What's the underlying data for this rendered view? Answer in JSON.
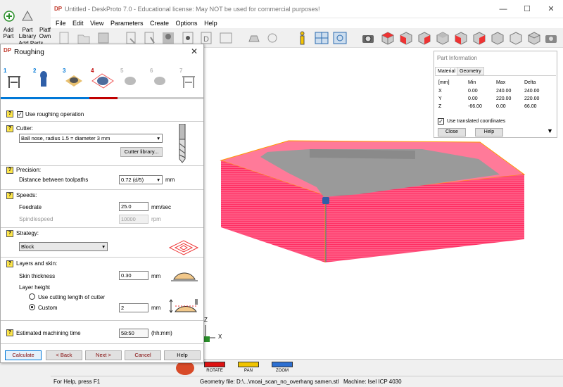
{
  "window": {
    "title": "Untitled - DeskProto 7.0 - Educational license: May NOT be used for commercial purposes!",
    "icon": "DP"
  },
  "bg_toolbar": {
    "add_part": [
      "Add",
      "Part"
    ],
    "part_library": [
      "Part",
      "Library"
    ],
    "platform": [
      "Platf",
      "Own"
    ],
    "add_parts": "Add Parts"
  },
  "menu": [
    "File",
    "Edit",
    "View",
    "Parameters",
    "Create",
    "Options",
    "Help"
  ],
  "dialog": {
    "title": "Roughing",
    "steps": [
      "1",
      "2",
      "3",
      "4",
      "5",
      "6",
      "7"
    ],
    "use_roughing": "Use roughing operation",
    "cutter_label": "Cutter:",
    "cutter_value": "Ball nose, radius 1.5 = diameter 3 mm",
    "cutter_library": "Cutter library...",
    "precision_label": "Precision:",
    "distance_label": "Distance between toolpaths",
    "distance_value": "0.72  (d/5)",
    "distance_unit": "mm",
    "speeds_label": "Speeds:",
    "feedrate_label": "Feedrate",
    "feedrate_value": "25.0",
    "feedrate_unit": "mm/sec",
    "spindle_label": "Spindlespeed",
    "spindle_value": "10000",
    "spindle_unit": "rpm",
    "strategy_label": "Strategy:",
    "strategy_value": "Block",
    "layers_label": "Layers and skin:",
    "skin_label": "Skin thickness",
    "skin_value": "0.30",
    "skin_unit": "mm",
    "layer_height_label": "Layer height",
    "opt_cutting_length": "Use cutting length of cutter",
    "opt_custom": "Custom",
    "custom_value": "2",
    "custom_unit": "mm",
    "est_label": "Estimated machining time",
    "est_value": "58:50",
    "est_unit": "(hh:mm)",
    "buttons": {
      "calculate": "Calculate",
      "back": "< Back",
      "next": "Next >",
      "cancel": "Cancel",
      "help": "Help"
    }
  },
  "part_info": {
    "title": "Part Information",
    "tabs": [
      "Material",
      "Geometry"
    ],
    "headers": [
      "[mm]",
      "Min",
      "Max",
      "Delta"
    ],
    "rows": [
      [
        "X",
        "0.00",
        "240.00",
        "240.00"
      ],
      [
        "Y",
        "0.00",
        "220.00",
        "220.00"
      ],
      [
        "Z",
        "-66.00",
        "0.00",
        "66.00"
      ]
    ],
    "use_translated": "Use translated coordinates",
    "close": "Close",
    "help": "Help"
  },
  "axes": {
    "x": "X",
    "z": "Z"
  },
  "view_modes": {
    "rotate": "ROTATE",
    "pan": "PAN",
    "zoom": "ZOOM"
  },
  "status": {
    "help": "For Help, press F1",
    "geometry": "Geometry file: D:\\...\\moai_scan_no_overhang samen.stl",
    "machine": "Machine: Isel ICP 4030"
  },
  "colors": {
    "accent_blue": "#0078d7",
    "step_red": "#c00000",
    "block_pink": "#ff3d6e",
    "model_gray": "#9a9a9a"
  }
}
